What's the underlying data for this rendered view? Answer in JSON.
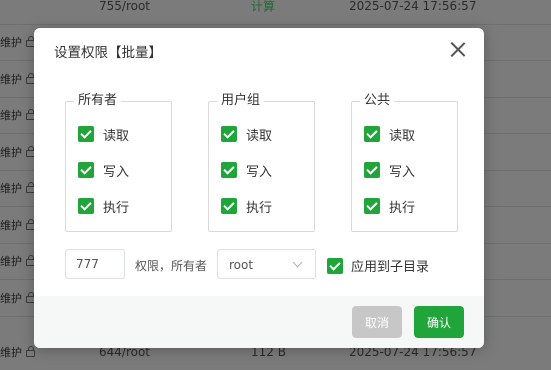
{
  "background": {
    "rows": [
      {
        "left": "",
        "c1": "755/root",
        "c2": "计算",
        "c2_green": true,
        "c3": "2025-07-24 17:56:57"
      },
      {
        "left": "维护",
        "c1": "",
        "c2": "",
        "c3": ""
      },
      {
        "left": "维护",
        "c1": "",
        "c2": "",
        "c3": ""
      },
      {
        "left": "维护",
        "c1": "",
        "c2": "",
        "c3": ""
      },
      {
        "left": "维护",
        "c1": "",
        "c2": "",
        "c3": ""
      },
      {
        "left": "维护",
        "c1": "",
        "c2": "",
        "c3": ""
      },
      {
        "left": "维护",
        "c1": "",
        "c2": "",
        "c3": ""
      },
      {
        "left": "维护",
        "c1": "",
        "c2": "",
        "c3": ""
      },
      {
        "left": "维护",
        "c1": "",
        "c2": "",
        "c3": ""
      },
      {
        "left": "维护",
        "c1": "644/root",
        "c2": "112 B",
        "c2_green": false,
        "c3": "2025-07-24 17:56:57"
      }
    ]
  },
  "modal": {
    "title": "设置权限【批量】",
    "groups": [
      {
        "legend": "所有者",
        "permissions": [
          {
            "label": "读取",
            "checked": true
          },
          {
            "label": "写入",
            "checked": true
          },
          {
            "label": "执行",
            "checked": true
          }
        ]
      },
      {
        "legend": "用户组",
        "permissions": [
          {
            "label": "读取",
            "checked": true
          },
          {
            "label": "写入",
            "checked": true
          },
          {
            "label": "执行",
            "checked": true
          }
        ]
      },
      {
        "legend": "公共",
        "permissions": [
          {
            "label": "读取",
            "checked": true
          },
          {
            "label": "写入",
            "checked": true
          },
          {
            "label": "执行",
            "checked": true
          }
        ]
      }
    ],
    "permission_value": "777",
    "owner_label": "权限，所有者",
    "owner_value": "root",
    "apply_subdirs_label": "应用到子目录",
    "apply_subdirs_checked": true,
    "cancel_label": "取消",
    "confirm_label": "确认"
  },
  "colors": {
    "accent": "#20a53a",
    "cancel_bg": "#c7c7c7",
    "overlay": "#7b7b7b"
  },
  "icons": [
    "close-icon",
    "checkbox-checked-icon",
    "chevron-down-icon",
    "lock-icon"
  ]
}
